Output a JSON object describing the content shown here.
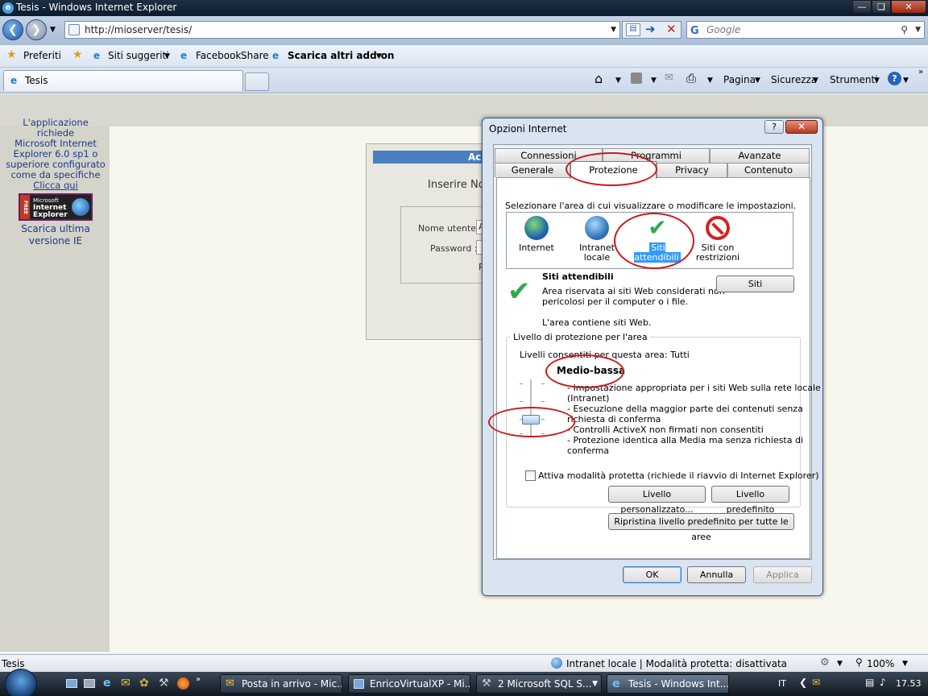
{
  "window": {
    "title": "Tesis - Windows Internet Explorer"
  },
  "address": {
    "url": "http://mioserver/tesis/",
    "search_placeholder": "Google"
  },
  "favorites": {
    "preferiti": "Preferiti",
    "siti_suggeriti": "Siti suggeriti",
    "facebook": "Facebook",
    "share": "Share",
    "addons": "Scarica altri add-on"
  },
  "tabs": {
    "active_tab": "Tesis"
  },
  "commandbar": {
    "pagina": "Pagina",
    "sicurezza": "Sicurezza",
    "strumenti": "Strumenti"
  },
  "page": {
    "notice_line1": "L'applicazione richiede",
    "notice_line2": "Microsoft Internet",
    "notice_line3": "Explorer 6.0 sp1 o",
    "notice_line4": "superiore configurato",
    "notice_line5": "come da specifiche",
    "notice_link": "Clicca qui",
    "logo_l1": "Microsoft",
    "logo_l2": "Internet",
    "logo_l3": "Explorer",
    "logo_free": "FREE",
    "download_l1": "Scarica ultima",
    "download_l2": "versione IE",
    "login_head": "Ac",
    "login_insert": "Inserire No",
    "username_label": "Nome utente :",
    "password_label": "Password :",
    "partial_r": "R",
    "partial_a": "A"
  },
  "dialog": {
    "title": "Opzioni Internet",
    "help": "?",
    "tabs_row1": [
      "Connessioni",
      "Programmi",
      "Avanzate"
    ],
    "tabs_row2": [
      "Generale",
      "Protezione",
      "Privacy",
      "Contenuto"
    ],
    "select_zone_label": "Selezionare l'area di cui visualizzare o modificare le impostazioni.",
    "zones": {
      "internet": "Internet",
      "intranet": "Intranet locale",
      "trusted": "Siti attendibili",
      "restricted_l1": "Siti con",
      "restricted_l2": "restrizioni"
    },
    "zone_title": "Siti attendibili",
    "zone_desc_l1": "Area riservata ai siti Web considerati non",
    "zone_desc_l2": "pericolosi per il computer o i file.",
    "zone_contains": "L'area contiene siti Web.",
    "siti_button": "Siti",
    "group_label": "Livello di protezione per l'area",
    "allowed_levels": "Livelli consentiti per questa area: Tutti",
    "level_name": "Medio-bassa",
    "level_desc": [
      "- Impostazione appropriata per i siti Web sulla rete locale",
      "(Intranet)",
      "- Esecuzione della maggior parte dei contenuti senza",
      "richiesta di conferma",
      "- Controlli ActiveX non firmati non consentiti",
      "- Protezione identica alla Media ma senza richiesta di",
      "conferma"
    ],
    "slider_level": 0.33,
    "protected_mode": "Attiva modalità protetta (richiede il riavvio di Internet Explorer)",
    "custom_level": "Livello personalizzato...",
    "default_level": "Livello predefinito",
    "reset_all": "Ripristina livello predefinito per tutte le aree",
    "ok": "OK",
    "cancel": "Annulla",
    "apply": "Applica"
  },
  "statusbar": {
    "left": "Tesis",
    "zone": "Intranet locale | Modalità protetta: disattivata",
    "zoom": "100%"
  },
  "taskbar": {
    "tasks": [
      "Posta in arrivo - Mic...",
      "EnricoVirtualXP - Mi...",
      "2 Microsoft SQL S...",
      "Tesis - Windows Int..."
    ],
    "lang": "IT",
    "clock": "17.53"
  },
  "colors": {
    "accent": "#3b78c8",
    "annotation_red": "#d01818",
    "selected_zone": "#3399ff"
  }
}
